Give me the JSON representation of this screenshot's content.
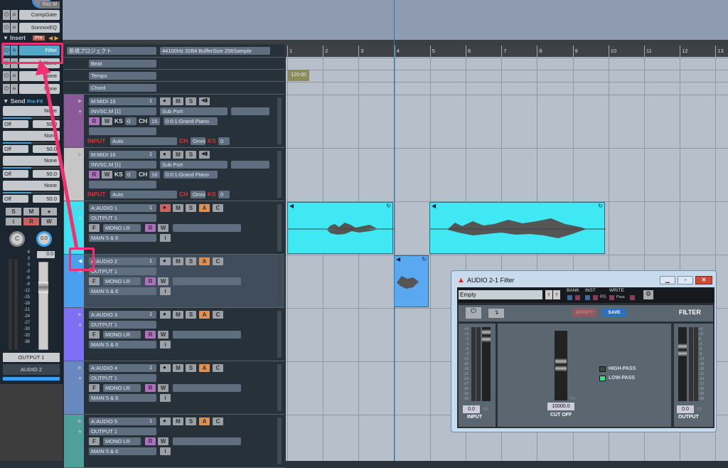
{
  "mixer": {
    "rec_label": "Rec M",
    "inserts_top": [
      "CompGate",
      "SonnoxEQ"
    ],
    "insert_header": "Insert",
    "insert_pre": "Pre",
    "inserts": [
      "Filter",
      "None",
      "None",
      "None"
    ],
    "send_header": "Send",
    "send_mode": "Pre-FX",
    "sends": [
      {
        "name": "None",
        "state": "Off",
        "value": "50.0"
      },
      {
        "name": "None",
        "state": "Off",
        "value": "50.0"
      },
      {
        "name": "None",
        "state": "Off",
        "value": "50.0"
      },
      {
        "name": "None",
        "state": "Off",
        "value": "50.0"
      }
    ],
    "buttons": [
      "S",
      "M",
      "●",
      "i",
      "R",
      "W"
    ],
    "pan_label": "C",
    "knob_value": "0.0",
    "fader_value": "0.0",
    "scale": [
      "6",
      "3",
      "0",
      "-3",
      "-6",
      "-9",
      "-12",
      "-15",
      "-18",
      "-21",
      "-24",
      "-27",
      "-30",
      "-33",
      "-36"
    ],
    "output": "OUTPUT 1",
    "track_name": "AUDIO 2"
  },
  "project": {
    "name": "新規プロジェクト",
    "info": "44100Hz 32Bit BufferSize 256Sample",
    "rows": [
      "Beat",
      "Tempo",
      "Chord"
    ],
    "tempo_value": "120.00"
  },
  "ruler": [
    "1",
    "2",
    "3",
    "4",
    "5",
    "6",
    "7",
    "8",
    "9",
    "10",
    "11",
    "12",
    "13"
  ],
  "midi_tracks": [
    {
      "name": "M:MIDI 15",
      "num": "1",
      "device": "INVSC,M [1]",
      "port": "Sub Port",
      "ks": "0",
      "ch": "15",
      "program": "0:0:1:Grand Piano",
      "input": "Auto",
      "in_ch": "Omni",
      "in_ks": "0",
      "color": "#8a5a98"
    },
    {
      "name": "M:MIDI 16",
      "num": "1",
      "device": "INVSC,M [1]",
      "port": "Sub Port",
      "ks": "0",
      "ch": "16",
      "program": "0:0:1:Grand Piano",
      "input": "Auto",
      "in_ch": "Omni",
      "in_ks": "0",
      "color": "#c6c6c6"
    }
  ],
  "midi_labels": {
    "r": "R",
    "w": "W",
    "ks": "KS",
    "ch": "CH",
    "input": "INPUT",
    "m": "M",
    "s": "S"
  },
  "audio_tracks": [
    {
      "name": "A:AUDIO 1",
      "num": "1",
      "output": "OUTPUT 1",
      "mode": "MONO LR",
      "bus": "MAIN 5 & 6",
      "color": "#3fe2f0"
    },
    {
      "name": "A:AUDIO 2",
      "num": "1",
      "output": "OUTPUT 1",
      "mode": "MONO LR",
      "bus": "MAIN 5 & 6",
      "color": "#4a9ff0"
    },
    {
      "name": "A:AUDIO 3",
      "num": "1",
      "output": "OUTPUT 1",
      "mode": "MONO LR",
      "bus": "MAIN 5 & 6",
      "color": "#7f6ff4"
    },
    {
      "name": "A:AUDIO 4",
      "num": "1",
      "output": "OUTPUT 1",
      "mode": "MONO LR",
      "bus": "MAIN 5 & 6",
      "color": "#6a88c0"
    },
    {
      "name": "A:AUDIO 5",
      "num": "1",
      "output": "OUTPUT 1",
      "mode": "MONO LR",
      "bus": "MAIN 5 & 6",
      "color": "#4f9f9c"
    }
  ],
  "audio_labels": {
    "m": "M",
    "s": "S",
    "a": "A",
    "c": "C",
    "f": "F",
    "r": "R",
    "w": "W",
    "i": "i"
  },
  "plugin": {
    "title": "AUDIO 2-1 Filter",
    "preset": "Empty",
    "bank": "BANK",
    "inst": "INST",
    "pg": "PG",
    "write": "WRITE",
    "para": "Para",
    "modify": "MODIFY",
    "save": "SAVE",
    "name": "FILTER",
    "input_value": "0.0",
    "output_value": "0.0",
    "db": "dB",
    "input_label": "INPUT",
    "output_label": "OUTPUT",
    "cutoff_value": "10000.0",
    "hz": "Hz",
    "cutoff_label": "CUT OFF",
    "high_pass": "HIGH-PASS",
    "low_pass": "LOW-PASS",
    "low_pass_on": true,
    "scale": [
      "+6",
      "+3",
      "0",
      "-3",
      "-6",
      "-9",
      "-12",
      "-15",
      "-18",
      "-21",
      "-24",
      "-27",
      "-30",
      "-33",
      "-36"
    ]
  },
  "colors": {
    "highlight": "#f0306f",
    "playhead": "#1e7fb8",
    "clip_audio1": "#3fe8f2",
    "clip_audio2": "#5aa8f0"
  }
}
